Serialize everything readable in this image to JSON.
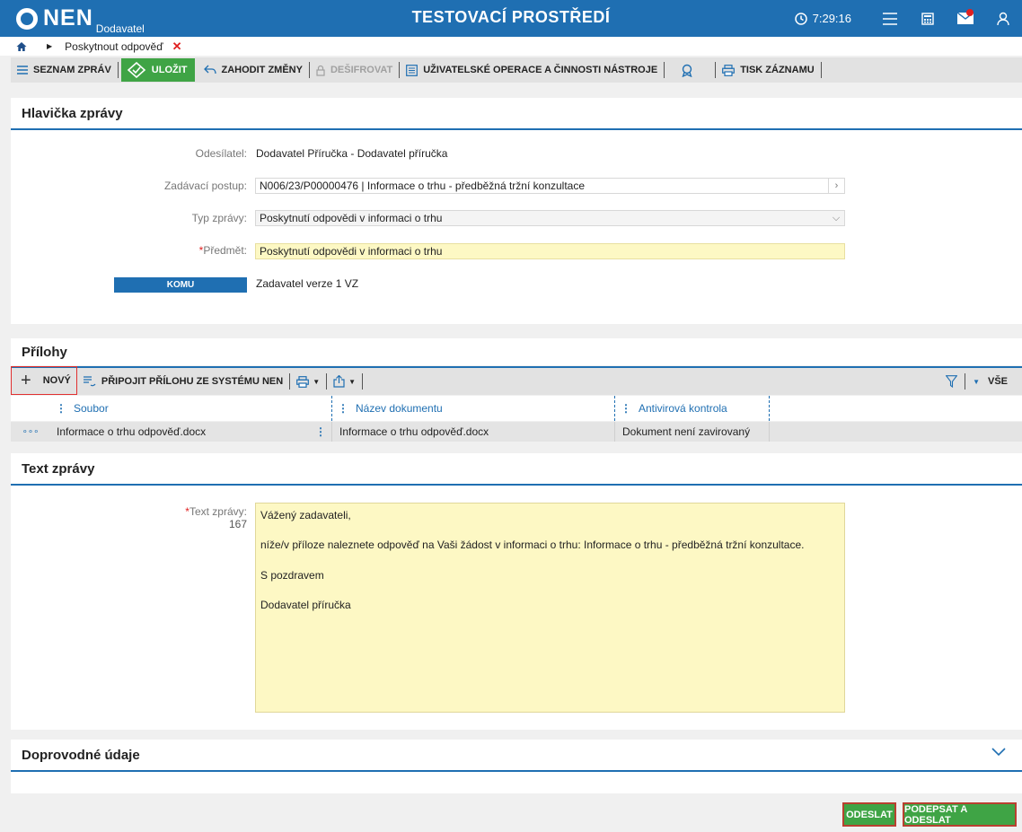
{
  "header": {
    "logo_text": "NEN",
    "logo_sub": "Dodavatel",
    "env_title": "TESTOVACÍ PROSTŘEDÍ",
    "time": "7:29:16"
  },
  "breadcrumb": {
    "current": "Poskytnout odpověď",
    "close": "✕"
  },
  "toolbar": {
    "list_label": "SEZNAM ZPRÁV",
    "save_label": "ULOŽIT",
    "discard_label": "ZAHODIT ZMĚNY",
    "decrypt_label": "DEŠIFROVAT",
    "user_ops_label": "UŽIVATELSKÉ OPERACE A ČINNOSTI NÁSTROJE",
    "print_label": "TISK ZÁZNAMU"
  },
  "header_section": {
    "title": "Hlavička zprávy",
    "sender_label": "Odesílatel:",
    "sender_value": "Dodavatel Příručka - Dodavatel příručka",
    "procedure_label": "Zadávací postup:",
    "procedure_value": "N006/23/P00000476 | Informace o trhu - předběžná tržní konzultace",
    "type_label": "Typ zprávy:",
    "type_value": "Poskytnutí odpovědi v informaci o trhu",
    "subject_req": "*",
    "subject_label": "Předmět:",
    "subject_value": "Poskytnutí odpovědi v informaci o trhu",
    "to_button": "KOMU",
    "to_value": "Zadavatel verze 1 VZ"
  },
  "attachments": {
    "title": "Přílohy",
    "new_label": "NOVÝ",
    "attach_label": "PŘIPOJIT PŘÍLOHU ZE SYSTÉMU NEN",
    "filter_all": "VŠE",
    "columns": [
      "Soubor",
      "Název dokumentu",
      "Antivirová kontrola"
    ],
    "rows": [
      {
        "menu": "∘∘∘",
        "file": "Informace o trhu odpověď.docx",
        "name": "Informace o trhu odpověď.docx",
        "antivirus": "Dokument není zavirovaný"
      }
    ]
  },
  "message": {
    "title": "Text zprávy",
    "req": "*",
    "label": "Text zprávy:",
    "count": "167",
    "lines": [
      "Vážený zadavateli,",
      "níže/v příloze naleznete odpověď na Vaši žádost v informaci o trhu: Informace o trhu - předběžná tržní konzultace.",
      "S pozdravem",
      "Dodavatel příručka"
    ]
  },
  "accompanying": {
    "title": "Doprovodné údaje"
  },
  "footer": {
    "send_label": "ODESLAT",
    "sign_send_label": "PODEPSAT A ODESLAT"
  },
  "colors": {
    "primary": "#1f6fb2",
    "success": "#3fa445",
    "required_yellow": "#fdf8c4",
    "danger": "#e02020"
  }
}
